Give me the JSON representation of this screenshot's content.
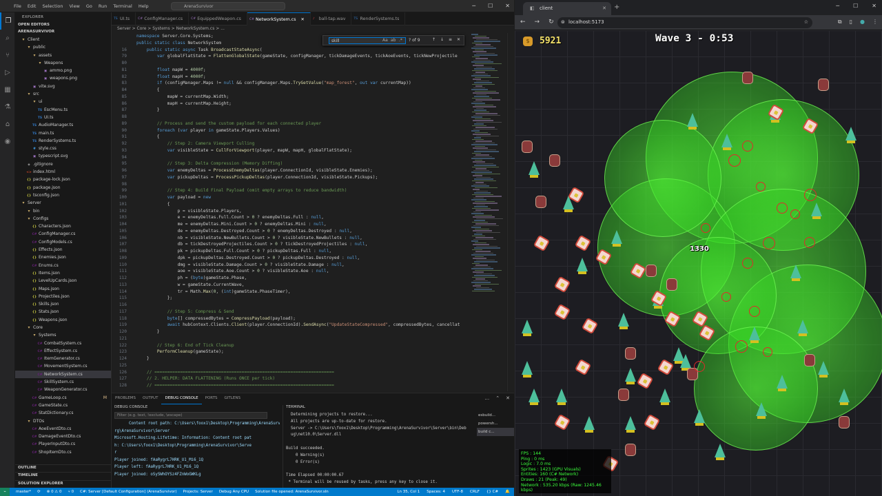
{
  "vscode": {
    "menu": [
      "File",
      "Edit",
      "Selection",
      "View",
      "Go",
      "Run",
      "Terminal",
      "Help"
    ],
    "search_placeholder": "ArenaSurvivor",
    "explorer_header": "EXPLORER",
    "open_editors": "OPEN EDITORS",
    "workspace": "ARENASURVIVOR",
    "tree": [
      {
        "label": "Client",
        "depth": 1,
        "kind": "folder"
      },
      {
        "label": "public",
        "depth": 2,
        "kind": "folder"
      },
      {
        "label": "assets",
        "depth": 3,
        "kind": "folder"
      },
      {
        "label": "Weapons",
        "depth": 4,
        "kind": "folder"
      },
      {
        "label": "ammo.png",
        "depth": 5,
        "kind": "img"
      },
      {
        "label": "weapons.png",
        "depth": 5,
        "kind": "img"
      },
      {
        "label": "vite.svg",
        "depth": 3,
        "kind": "img"
      },
      {
        "label": "src",
        "depth": 2,
        "kind": "folder"
      },
      {
        "label": "ui",
        "depth": 3,
        "kind": "folder"
      },
      {
        "label": "EscMenu.ts",
        "depth": 4,
        "kind": "ts"
      },
      {
        "label": "UI.ts",
        "depth": 4,
        "kind": "ts"
      },
      {
        "label": "AudioManager.ts",
        "depth": 3,
        "kind": "ts"
      },
      {
        "label": "main.ts",
        "depth": 3,
        "kind": "ts"
      },
      {
        "label": "RenderSystems.ts",
        "depth": 3,
        "kind": "ts"
      },
      {
        "label": "style.css",
        "depth": 3,
        "kind": "css"
      },
      {
        "label": "typescript.svg",
        "depth": 3,
        "kind": "img"
      },
      {
        "label": ".gitignore",
        "depth": 2,
        "kind": "file"
      },
      {
        "label": "index.html",
        "depth": 2,
        "kind": "html"
      },
      {
        "label": "package-lock.json",
        "depth": 2,
        "kind": "json"
      },
      {
        "label": "package.json",
        "depth": 2,
        "kind": "json"
      },
      {
        "label": "tsconfig.json",
        "depth": 2,
        "kind": "json"
      },
      {
        "label": "Server",
        "depth": 1,
        "kind": "folder"
      },
      {
        "label": "bin",
        "depth": 2,
        "kind": "folder"
      },
      {
        "label": "Configs",
        "depth": 2,
        "kind": "folder"
      },
      {
        "label": "Characters.json",
        "depth": 3,
        "kind": "json"
      },
      {
        "label": "ConfigManager.cs",
        "depth": 3,
        "kind": "cs"
      },
      {
        "label": "ConfigModels.cs",
        "depth": 3,
        "kind": "cs"
      },
      {
        "label": "Effects.json",
        "depth": 3,
        "kind": "json"
      },
      {
        "label": "Enemies.json",
        "depth": 3,
        "kind": "json"
      },
      {
        "label": "Enums.cs",
        "depth": 3,
        "kind": "cs"
      },
      {
        "label": "Items.json",
        "depth": 3,
        "kind": "json"
      },
      {
        "label": "LevelUpCards.json",
        "depth": 3,
        "kind": "json"
      },
      {
        "label": "Maps.json",
        "depth": 3,
        "kind": "json"
      },
      {
        "label": "Projectiles.json",
        "depth": 3,
        "kind": "json"
      },
      {
        "label": "Skills.json",
        "depth": 3,
        "kind": "json"
      },
      {
        "label": "Stats.json",
        "depth": 3,
        "kind": "json"
      },
      {
        "label": "Weapons.json",
        "depth": 3,
        "kind": "json"
      },
      {
        "label": "Core",
        "depth": 2,
        "kind": "folder"
      },
      {
        "label": "Systems",
        "depth": 3,
        "kind": "folder"
      },
      {
        "label": "CombatSystem.cs",
        "depth": 4,
        "kind": "cs"
      },
      {
        "label": "EffectSystem.cs",
        "depth": 4,
        "kind": "cs"
      },
      {
        "label": "ItemGenerator.cs",
        "depth": 4,
        "kind": "cs"
      },
      {
        "label": "MovementSystem.cs",
        "depth": 4,
        "kind": "cs"
      },
      {
        "label": "NetworkSystem.cs",
        "depth": 4,
        "kind": "cs",
        "selected": true
      },
      {
        "label": "SkillSystem.cs",
        "depth": 4,
        "kind": "cs"
      },
      {
        "label": "WeaponGenerator.cs",
        "depth": 4,
        "kind": "cs"
      },
      {
        "label": "GameLoop.cs",
        "depth": 3,
        "kind": "cs",
        "badge": "M"
      },
      {
        "label": "GameState.cs",
        "depth": 3,
        "kind": "cs"
      },
      {
        "label": "StatDictionary.cs",
        "depth": 3,
        "kind": "cs"
      },
      {
        "label": "DTOs",
        "depth": 2,
        "kind": "folder"
      },
      {
        "label": "AoeEventDto.cs",
        "depth": 3,
        "kind": "cs"
      },
      {
        "label": "DamageEventDto.cs",
        "depth": 3,
        "kind": "cs"
      },
      {
        "label": "PlayerInputDto.cs",
        "depth": 3,
        "kind": "cs"
      },
      {
        "label": "ShopItemDto.cs",
        "depth": 3,
        "kind": "cs"
      }
    ],
    "sidebar_bottom": [
      "OUTLINE",
      "TIMELINE",
      "SOLUTION EXPLORER"
    ],
    "tabs": [
      {
        "label": "UI.ts",
        "active": false
      },
      {
        "label": "ConfigManager.cs",
        "active": false
      },
      {
        "label": "EquippedWeapon.cs",
        "active": false
      },
      {
        "label": "NetworkSystem.cs",
        "active": true
      },
      {
        "label": "ball-tap.wav",
        "active": false
      },
      {
        "label": "RenderSystems.ts",
        "active": false
      }
    ],
    "breadcrumb": "Server > Core > Systems > NetworkSystem.cs > ...",
    "find": {
      "query": "skill",
      "aa": "Aa",
      "ab": "ab",
      "rx": ".*",
      "count": "? of 9"
    },
    "code": [
      {
        "n": "",
        "t": "namespace Server.Core.Systems;",
        "s": true
      },
      {
        "n": "",
        "t": "public static class NetworkSystem",
        "s": true
      },
      {
        "n": "16",
        "t": "    public static async Task BroadcastStateAsync(",
        "s": true
      },
      {
        "n": "79",
        "t": "        var globalFlatState = FlattenGlobalState(gameState, configManager, tickDamageEvents, tickAoeEvents, tickNewProjectile"
      },
      {
        "n": "80",
        "t": ""
      },
      {
        "n": "81",
        "t": "        float mapW = 4000f;"
      },
      {
        "n": "82",
        "t": "        float mapH = 4000f;"
      },
      {
        "n": "83",
        "t": "        if (configManager.Maps != null && configManager.Maps.TryGetValue(\"map_forest\", out var currentMap))"
      },
      {
        "n": "84",
        "t": "        {"
      },
      {
        "n": "85",
        "t": "            mapW = currentMap.Width;"
      },
      {
        "n": "86",
        "t": "            mapH = currentMap.Height;"
      },
      {
        "n": "87",
        "t": "        }"
      },
      {
        "n": "88",
        "t": ""
      },
      {
        "n": "89",
        "t": "        // Process and send the custom payload for each connected player"
      },
      {
        "n": "90",
        "t": "        foreach (var player in gameState.Players.Values)"
      },
      {
        "n": "91",
        "t": "        {"
      },
      {
        "n": "92",
        "t": "            // Step 2: Camera Viewport Culling"
      },
      {
        "n": "93",
        "t": "            var visibleState = CullForViewport(player, mapW, mapH, globalFlatState);"
      },
      {
        "n": "94",
        "t": ""
      },
      {
        "n": "95",
        "t": "            // Step 3: Delta Compression (Memory Diffing)"
      },
      {
        "n": "96",
        "t": "            var enemyDeltas = ProcessEnemyDeltas(player.ConnectionId, visibleState.Enemies);"
      },
      {
        "n": "97",
        "t": "            var pickupDeltas = ProcessPickupDeltas(player.ConnectionId, visibleState.Pickups);"
      },
      {
        "n": "98",
        "t": ""
      },
      {
        "n": "99",
        "t": "            // Step 4: Build Final Payload (omit empty arrays to reduce bandwidth)"
      },
      {
        "n": "100",
        "t": "            var payload = new"
      },
      {
        "n": "101",
        "t": "            {"
      },
      {
        "n": "102",
        "t": "                p = visibleState.Players,"
      },
      {
        "n": "103",
        "t": "                e = enemyDeltas.Full.Count > 0 ? enemyDeltas.Full : null,"
      },
      {
        "n": "104",
        "t": "                me = enemyDeltas.Mini.Count > 0 ? enemyDeltas.Mini : null,"
      },
      {
        "n": "105",
        "t": "                de = enemyDeltas.Destroyed.Count > 0 ? enemyDeltas.Destroyed : null,"
      },
      {
        "n": "106",
        "t": "                nb = visibleState.NewBullets.Count > 0 ? visibleState.NewBullets : null,"
      },
      {
        "n": "107",
        "t": "                db = tickDestroyedProjectiles.Count > 0 ? tickDestroyedProjectiles : null,"
      },
      {
        "n": "108",
        "t": "                pk = pickupDeltas.Full.Count > 0 ? pickupDeltas.Full : null,"
      },
      {
        "n": "109",
        "t": "                dpk = pickupDeltas.Destroyed.Count > 0 ? pickupDeltas.Destroyed : null,"
      },
      {
        "n": "110",
        "t": "                dmg = visibleState.Damage.Count > 0 ? visibleState.Damage : null,"
      },
      {
        "n": "111",
        "t": "                aoe = visibleState.Aoe.Count > 0 ? visibleState.Aoe : null,"
      },
      {
        "n": "112",
        "t": "                ph = (byte)gameState.Phase,"
      },
      {
        "n": "113",
        "t": "                w = gameState.CurrentWave,"
      },
      {
        "n": "114",
        "t": "                tr = Math.Max(0, (int)gameState.PhaseTimer),"
      },
      {
        "n": "115",
        "t": "            };"
      },
      {
        "n": "116",
        "t": ""
      },
      {
        "n": "117",
        "t": "            // Step 5: Compress & Send"
      },
      {
        "n": "118",
        "t": "            byte[] compressedBytes = CompressPayload(payload);"
      },
      {
        "n": "119",
        "t": "            await hubContext.Clients.Client(player.ConnectionId).SendAsync(\"UpdateStateCompressed\", compressedBytes, cancellat"
      },
      {
        "n": "120",
        "t": "        }"
      },
      {
        "n": "121",
        "t": ""
      },
      {
        "n": "122",
        "t": "        // Step 6: End of Tick Cleanup"
      },
      {
        "n": "123",
        "t": "        PerformCleanup(gameState);"
      },
      {
        "n": "124",
        "t": "    }"
      },
      {
        "n": "125",
        "t": ""
      },
      {
        "n": "126",
        "t": "    // ======================================================================"
      },
      {
        "n": "127",
        "t": "    // 2. HELPER: DATA FLATTENING (Runs ONCE per tick)"
      },
      {
        "n": "128",
        "t": "    // ======================================================================"
      }
    ],
    "panel_tabs": [
      "PROBLEMS",
      "OUTPUT",
      "DEBUG CONSOLE",
      "PORTS",
      "GITLENS"
    ],
    "panel_active": "DEBUG CONSOLE",
    "debug_header": "DEBUG CONSOLE",
    "debug_filter": "Filter (e.g. text, !exclude, \\escape)",
    "debug_lines": [
      "      Content root path: C:\\Users\\foox1\\Desktop\\Programming\\ArenaSurvivor\\Server",
      "rg\\ArenaSurvivor\\Server",
      "Microsoft.Hosting.Lifetime: Information: Content root pat",
      "h: C:\\Users\\foox1\\Desktop\\Programming\\ArenaSurvivor\\Serve",
      "r",
      "Player joined: fAaRygrL7HRK_U1_Mi6_1Q",
      "Player left: fAaRygrL7HRK_U1_Mi6_1Q",
      "Player joined: oSySWhOYSz4FZnWoGWKLg"
    ],
    "terminal_header": "TERMINAL",
    "terminal_lines": [
      "  Determining projects to restore...",
      "  All projects are up-to-date for restore.",
      "  Server -> C:\\Users\\foox1\\Desktop\\Programming\\ArenaSurvivor\\Server\\bin\\Deb",
      "  ug\\net10.0\\Server.dll",
      "",
      "Build succeeded.",
      "    0 Warning(s)",
      "    0 Error(s)",
      "",
      "Time Elapsed 00:00:00.67",
      " * Terminal will be reused by tasks, press any key to close it."
    ],
    "terminal_list": [
      "esbuild...",
      "powersh...",
      "build c..."
    ],
    "status": {
      "branch": "master*",
      "sync": "⟳",
      "errors": "⊗ 0 ⚠ 0",
      "ports": "⑂ 0",
      "server": "C#: Server [Default Configuration] (ArenaSurvivor)",
      "projects": "Projects: Server",
      "debug": "Debug Any CPU",
      "solution": "Solution file opened: ArenaSurvivor.sln",
      "position": "Ln 35, Col 1",
      "spaces": "Spaces: 4",
      "encoding": "UTF-8",
      "eol": "CRLF",
      "lang": "{} C#",
      "bell": "🔔"
    }
  },
  "browser": {
    "tab_title": "client",
    "url": "localhost:5173"
  },
  "game": {
    "gold": "5921",
    "wave": "Wave 3 - 0:53",
    "stats": [
      "FPS    : 144",
      "Ping   : 0 ms",
      "Logic  : 7.0 ms",
      "Sprites : 1423 (GPU Visuals)",
      "Entities: 160 (C# Network)",
      "Draws  : 21 (Peak: 49)",
      "Network : 535.20 kbps (Raw: 1245.46 kbps)"
    ],
    "damage_popup": "1330",
    "colors": {
      "aura": "#5aff3c",
      "gold": "#f5e26a",
      "stats": "#3cff3c",
      "accent": "#007acc"
    }
  }
}
